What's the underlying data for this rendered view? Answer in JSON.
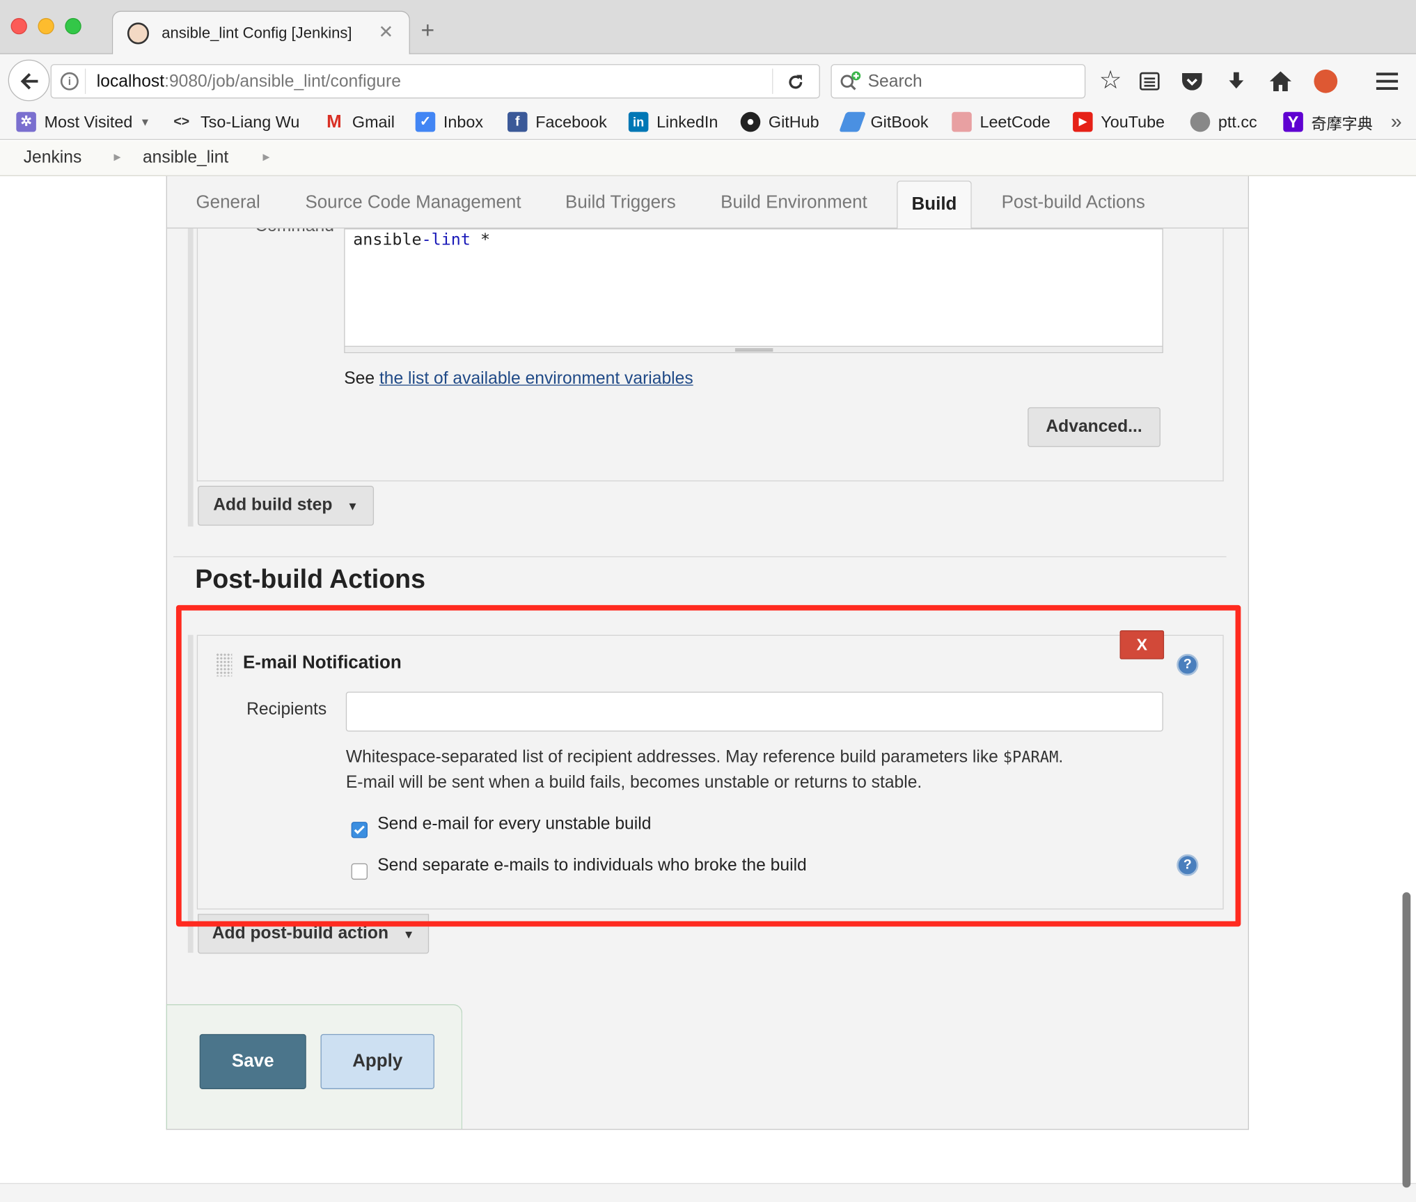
{
  "browser": {
    "tab_title": "ansible_lint Config [Jenkins]",
    "url_host": "localhost",
    "url_path": ":9080/job/ansible_lint/configure",
    "search_placeholder": "Search"
  },
  "bookmarks": [
    {
      "label": "Most Visited",
      "icon": "gear-icon",
      "color": "#7a6fcf"
    },
    {
      "label": "Tso-Liang Wu",
      "icon": "code-icon",
      "color": "#333333"
    },
    {
      "label": "Gmail",
      "icon": "gmail-icon",
      "color": "#d93025"
    },
    {
      "label": "Inbox",
      "icon": "inbox-icon",
      "color": "#4285f4"
    },
    {
      "label": "Facebook",
      "icon": "facebook-icon",
      "color": "#3b5998"
    },
    {
      "label": "LinkedIn",
      "icon": "linkedin-icon",
      "color": "#0077b5"
    },
    {
      "label": "GitHub",
      "icon": "github-icon",
      "color": "#222222"
    },
    {
      "label": "GitBook",
      "icon": "gitbook-icon",
      "color": "#4a90e2"
    },
    {
      "label": "LeetCode",
      "icon": "leetcode-icon",
      "color": "#e0787a"
    },
    {
      "label": "YouTube",
      "icon": "youtube-icon",
      "color": "#e62117"
    },
    {
      "label": "ptt.cc",
      "icon": "globe-icon",
      "color": "#777777"
    },
    {
      "label": "奇摩字典",
      "icon": "yahoo-icon",
      "color": "#5f01d1"
    }
  ],
  "breadcrumb": {
    "root": "Jenkins",
    "job": "ansible_lint"
  },
  "config_tabs": [
    "General",
    "Source Code Management",
    "Build Triggers",
    "Build Environment",
    "Build",
    "Post-build Actions"
  ],
  "build": {
    "command_label": "Command",
    "command_text_1": "ansible",
    "command_text_2": "-lint",
    "command_text_3": " *",
    "env_prefix": "See ",
    "env_link": "the list of available environment variables",
    "advanced_button": "Advanced...",
    "add_build_step": "Add build step"
  },
  "post_build": {
    "heading": "Post-build Actions",
    "section_title": "E-mail Notification",
    "delete_label": "X",
    "recipients_label": "Recipients",
    "recipients_value": "",
    "help_line1_a": "Whitespace-separated list of recipient addresses. May reference build parameters like ",
    "help_line1_code": "$PARAM",
    "help_line1_b": ".",
    "help_line2": "E-mail will be sent when a build fails, becomes unstable or returns to stable.",
    "checkbox_unstable_label": "Send e-mail for every unstable build",
    "checkbox_unstable_checked": true,
    "checkbox_individuals_label": "Send separate e-mails to individuals who broke the build",
    "checkbox_individuals_checked": false,
    "add_action": "Add post-build action"
  },
  "footer": {
    "save": "Save",
    "apply": "Apply"
  },
  "colors": {
    "highlight": "#ff2a1f",
    "save": "#4b758b",
    "apply": "#cde0f2",
    "delete": "#d24939",
    "link": "#204a87",
    "checked": "#3b8ee0"
  }
}
